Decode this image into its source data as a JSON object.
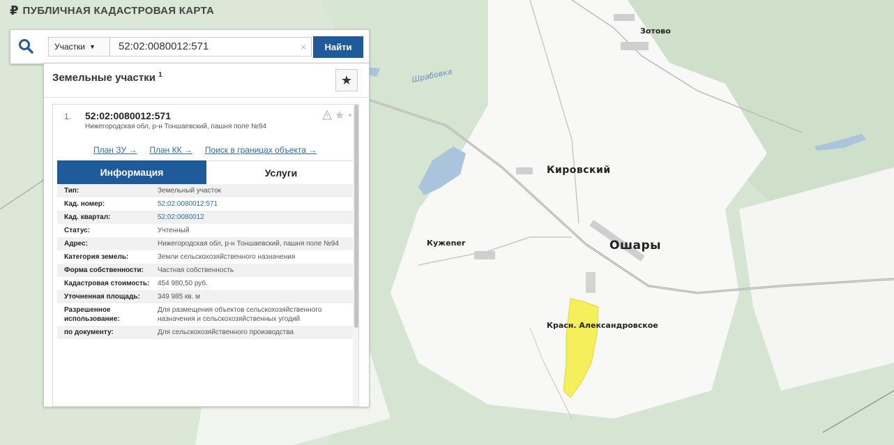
{
  "app": {
    "title": "ПУБЛИЧНАЯ КАДАСТРОВАЯ КАРТА",
    "logo_glyph": "₽"
  },
  "search": {
    "type_label": "Участки",
    "query_value": "52:02:0080012:571",
    "clear_glyph": "×",
    "find_label": "Найти"
  },
  "panel": {
    "title": "Земельные участки",
    "count": "1",
    "star_glyph": "★"
  },
  "result": {
    "number": "1.",
    "cad_number": "52:02:0080012:571",
    "address": "Нижегородская обл, р-н Тоншаевский, пашня поле №94",
    "links": [
      "План ЗУ →",
      "План КК →",
      "Поиск в границах объекта →"
    ],
    "tabs": [
      "Информация",
      "Услуги"
    ],
    "rows": [
      {
        "key": "Тип:",
        "value": "Земельный участок"
      },
      {
        "key": "Кад. номер:",
        "value": "52:02:0080012:571"
      },
      {
        "key": "Кад. квартал:",
        "value": "52:02:0080012"
      },
      {
        "key": "Статус:",
        "value": "Учтенный"
      },
      {
        "key": "Адрес:",
        "value": "Нижегородская обл, р-н Тоншаевский, пашня поле №94"
      },
      {
        "key": "Категория земель:",
        "value": "Земли сельскохозяйственного назначения"
      },
      {
        "key": "Форма собственности:",
        "value": "Частная собственность"
      },
      {
        "key": "Кадастровая стоимость:",
        "value": "454 980,50 руб."
      },
      {
        "key": "Уточненная площадь:",
        "value": "349 985 кв. м"
      },
      {
        "key": "Разрешенное использование:",
        "value": "Для размещения объектов сельскохозяйственного назначения и сельскохозяйственных угодий"
      },
      {
        "key": "по документу:",
        "value": "Для сельскохозяйственного производства"
      }
    ]
  },
  "map": {
    "labels": {
      "zotovo": "Зотово",
      "kirovsky": "Кировский",
      "kuzhener": "Кужener",
      "oshary": "Ошары",
      "krasn": "Красн. Александровское",
      "river": "Шрабовка"
    },
    "colors": {
      "forest": "#cfe1cc",
      "field": "#fafafa",
      "water": "#a9c4dc",
      "parcel": "#f5ef5c",
      "accent": "#1f5b9a"
    }
  }
}
